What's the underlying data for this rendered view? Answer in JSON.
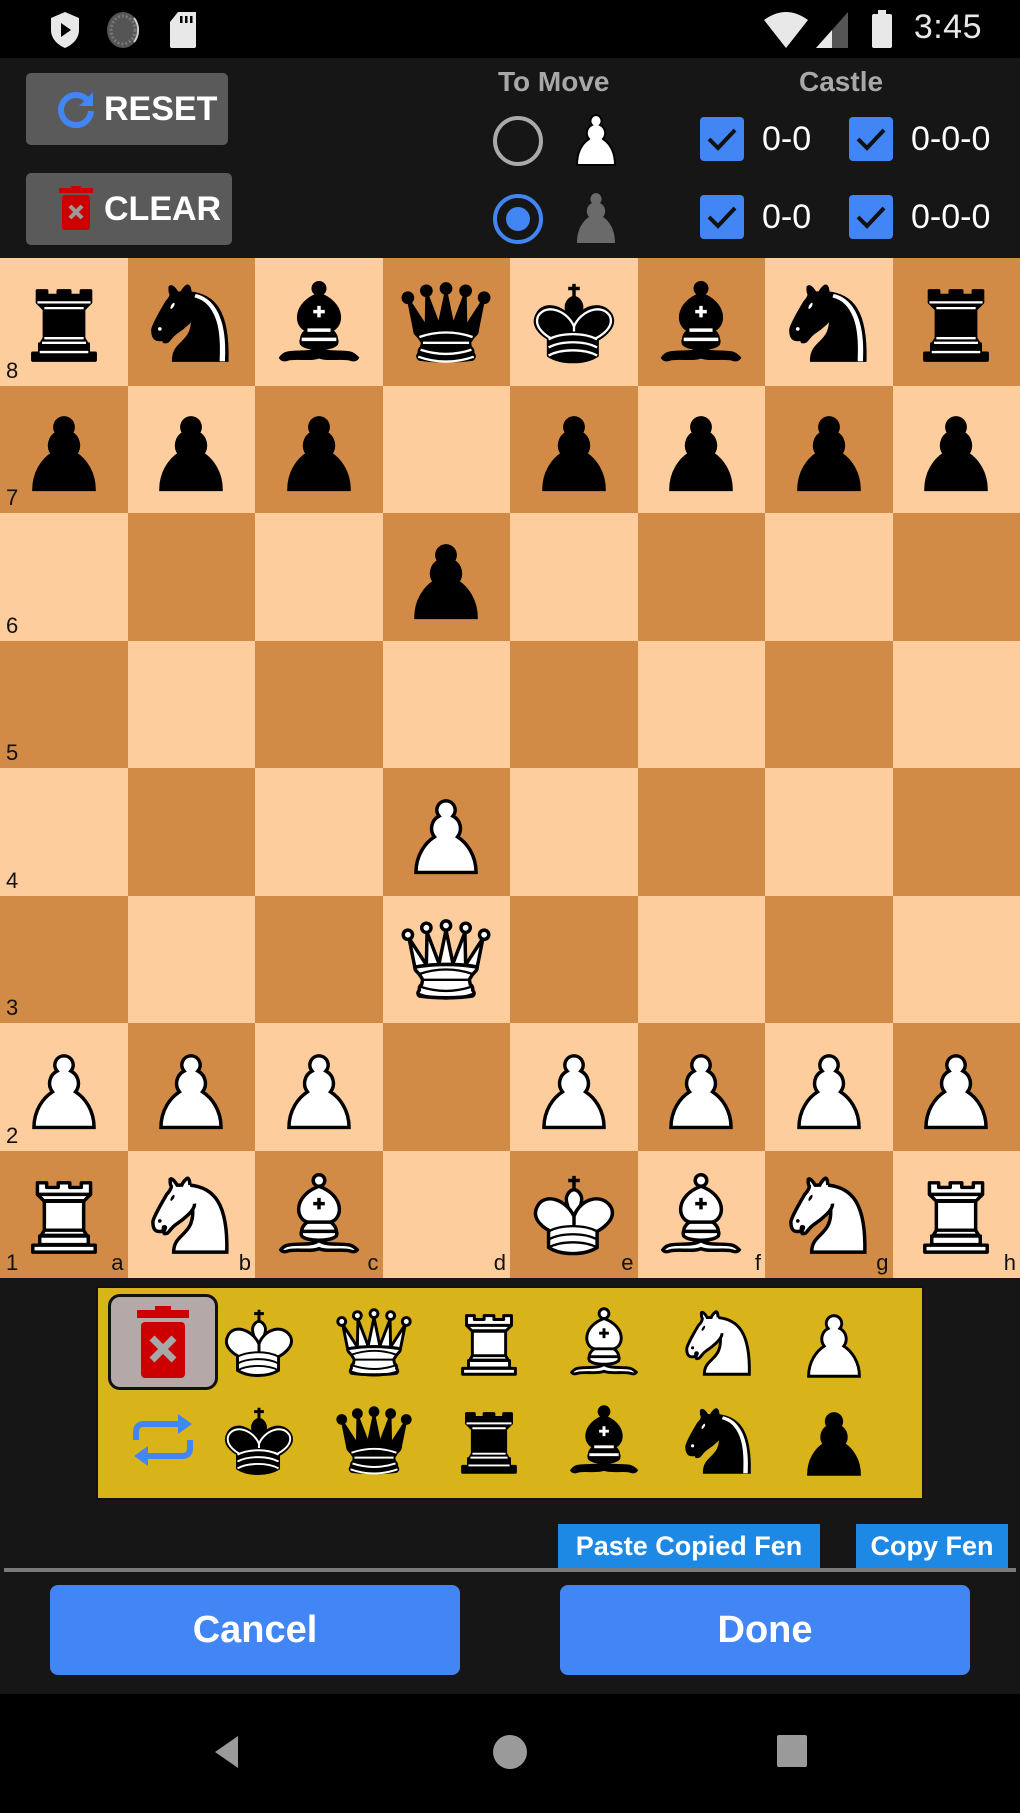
{
  "status_bar": {
    "time": "3:45",
    "left_icons": [
      "shield-play-icon",
      "loading-circle-icon",
      "sd-card-icon"
    ],
    "right_icons": [
      "wifi-icon",
      "cell-signal-icon",
      "battery-icon"
    ]
  },
  "toolbar": {
    "reset_label": "RESET",
    "clear_label": "CLEAR"
  },
  "to_move": {
    "label": "To Move",
    "options": [
      {
        "side": "white",
        "selected": false
      },
      {
        "side": "black",
        "selected": true
      }
    ]
  },
  "castle": {
    "label": "Castle",
    "white_kingside": {
      "label": "0-0",
      "checked": true
    },
    "white_queenside": {
      "label": "0-0-0",
      "checked": true
    },
    "black_kingside": {
      "label": "0-0",
      "checked": true
    },
    "black_queenside": {
      "label": "0-0-0",
      "checked": true
    }
  },
  "board": {
    "colors": {
      "light": "#fecd9d",
      "dark": "#d18b47"
    },
    "ranks": [
      "8",
      "7",
      "6",
      "5",
      "4",
      "3",
      "2",
      "1"
    ],
    "files": [
      "a",
      "b",
      "c",
      "d",
      "e",
      "f",
      "g",
      "h"
    ],
    "position": [
      [
        "r",
        "n",
        "b",
        "q",
        "k",
        "b",
        "n",
        "r"
      ],
      [
        "p",
        "p",
        "p",
        "",
        "p",
        "p",
        "p",
        "p"
      ],
      [
        "",
        "",
        "",
        "p",
        "",
        "",
        "",
        ""
      ],
      [
        "",
        "",
        "",
        "",
        "",
        "",
        "",
        ""
      ],
      [
        "",
        "",
        "",
        "P",
        "",
        "",
        "",
        ""
      ],
      [
        "",
        "",
        "",
        "Q",
        "",
        "",
        "",
        ""
      ],
      [
        "P",
        "P",
        "P",
        "",
        "P",
        "P",
        "P",
        "P"
      ],
      [
        "R",
        "N",
        "B",
        "",
        "K",
        "B",
        "N",
        "R"
      ]
    ]
  },
  "palette": {
    "selected": "delete",
    "row_white": [
      "delete",
      "K",
      "Q",
      "R",
      "B",
      "N",
      "P"
    ],
    "row_black": [
      "swap",
      "k",
      "q",
      "r",
      "b",
      "n",
      "p"
    ]
  },
  "fen": {
    "paste_label": "Paste Copied Fen",
    "copy_label": "Copy Fen"
  },
  "actions": {
    "cancel_label": "Cancel",
    "done_label": "Done"
  },
  "colors": {
    "accent": "#4285f4",
    "fen_button": "#1e88e5",
    "palette_bg": "#d8b319",
    "delete_red": "#cc0000"
  }
}
